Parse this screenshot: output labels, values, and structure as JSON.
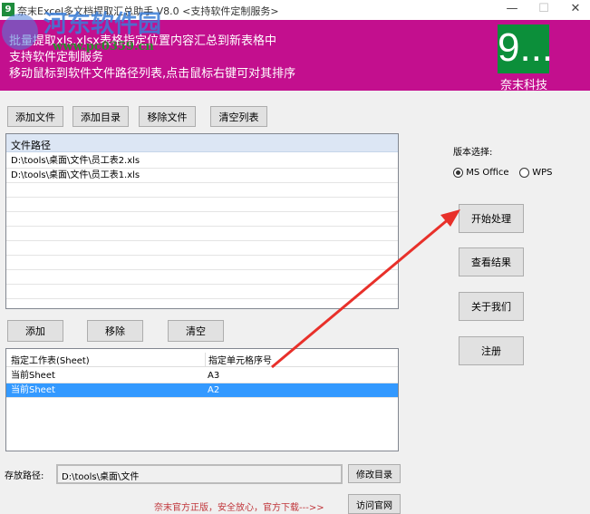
{
  "window": {
    "title": "奈末Excel多文档提取汇总助手 V8.0  <支持软件定制服务>",
    "minimize": "—",
    "maximize": "☐",
    "close": "✕"
  },
  "banner": {
    "lines": [
      "批量提取xls,xlsx表格指定位置内容汇总到新表格中",
      "支持软件定制服务",
      "移动鼠标到软件文件路径列表,点击鼠标右键可对其排序"
    ],
    "logo_mark": "9...",
    "logo_text": "奈末科技",
    "watermark": "河东软件园",
    "watermark_url": "www.pc0359.cn",
    "bg_color": "#c30f8e"
  },
  "file_toolbar": {
    "add_file": "添加文件",
    "add_dir": "添加目录",
    "remove_file": "移除文件",
    "clear_list": "清空列表"
  },
  "file_list": {
    "header": "文件路径",
    "rows": [
      "D:\\tools\\桌面\\文件\\员工表2.xls",
      "D:\\tools\\桌面\\文件\\员工表1.xls"
    ]
  },
  "version": {
    "label": "版本选择:",
    "options": [
      "MS Office",
      "WPS"
    ],
    "selected": "MS Office"
  },
  "actions": {
    "start": "开始处理",
    "view": "查看结果",
    "about": "关于我们",
    "register": "注册"
  },
  "sheet_toolbar": {
    "add": "添加",
    "remove": "移除",
    "clear": "清空"
  },
  "sheet_table": {
    "headers": [
      "指定工作表(Sheet)",
      "指定单元格序号"
    ],
    "rows": [
      [
        "当前Sheet",
        "A3"
      ],
      [
        "当前Sheet",
        "A2"
      ]
    ],
    "selected_row": 1
  },
  "save": {
    "label": "存放路径:",
    "value": "D:\\tools\\桌面\\文件",
    "change_button": "修改目录"
  },
  "footer": {
    "promo": "奈末官方正版，安全放心，官方下载--->>",
    "visit_button": "访问官网"
  }
}
